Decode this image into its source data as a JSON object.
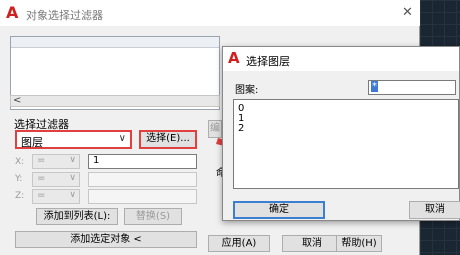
{
  "main_dialog": {
    "title": "对象选择过滤器",
    "select_filter_label": "选择过滤器",
    "filter_type_value": "图层",
    "select_button": "选择(E)...",
    "axes": [
      {
        "label": "X:",
        "operator": "=",
        "value": "1"
      },
      {
        "label": "Y:",
        "operator": "=",
        "value": ""
      },
      {
        "label": "Z:",
        "operator": "=",
        "value": ""
      }
    ],
    "add_to_list_button": "添加到列表(L):",
    "replace_button": "替换(S)",
    "add_selected_button": "添加选定对象 <",
    "edit_button_partial": "编",
    "middle_label_partial": "命",
    "apply_button": "应用(A)",
    "cancel_button": "取消",
    "help_button": "帮助(H)"
  },
  "sub_dialog": {
    "title": "选择图层",
    "pattern_label": "图案:",
    "pattern_value": "*",
    "layers": [
      "0",
      "1",
      "2"
    ],
    "ok_button": "确定",
    "cancel_button": "取消"
  },
  "colors": {
    "highlight_border": "#e04040",
    "arrow": "#e04040",
    "brand_red": "#d11f1f",
    "focus_blue": "#3c7fd0"
  }
}
